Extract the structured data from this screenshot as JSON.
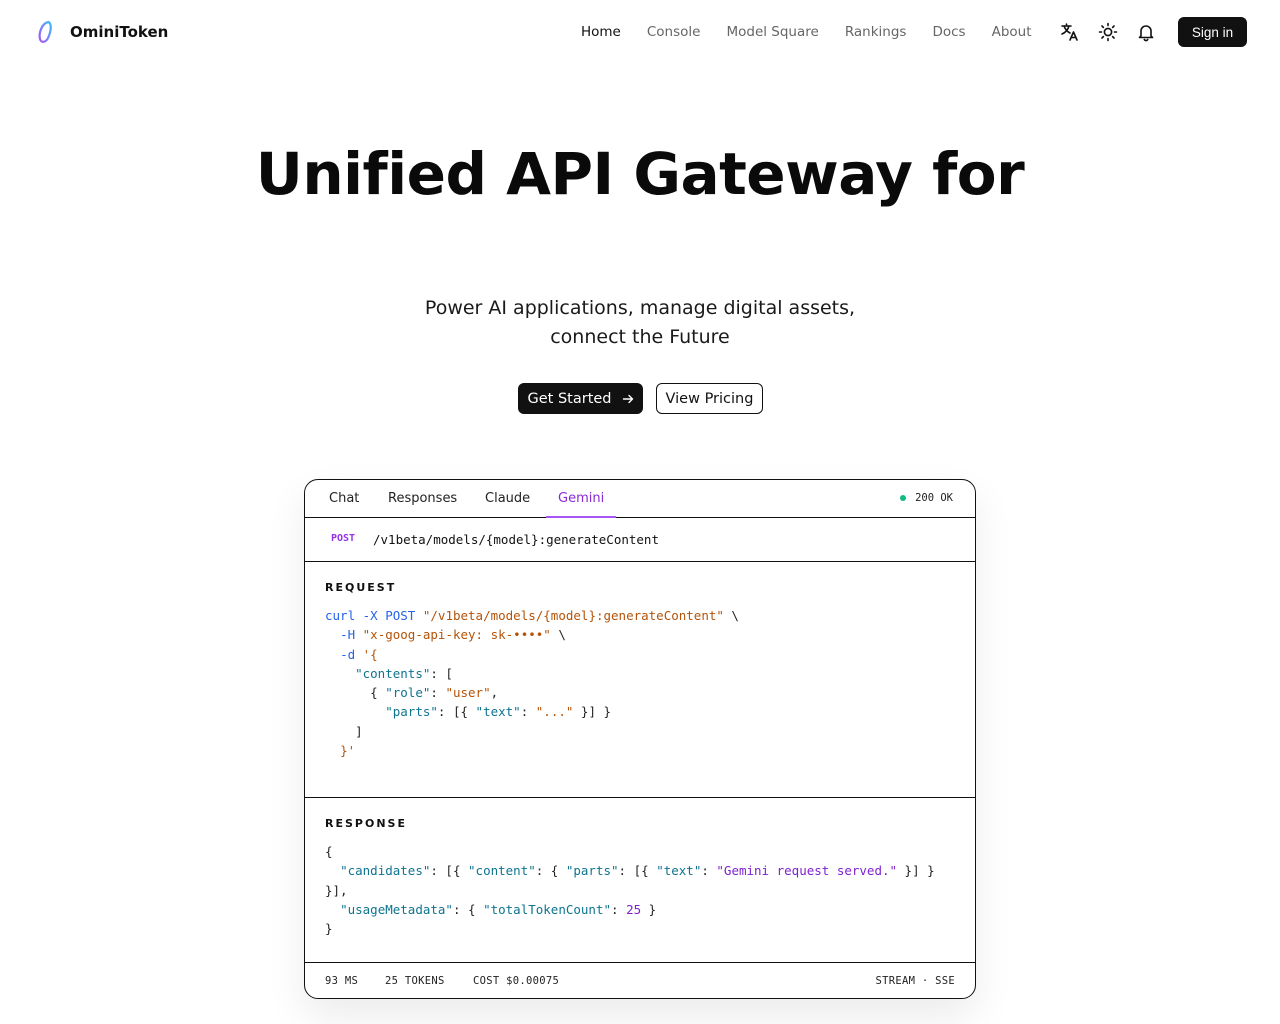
{
  "header": {
    "brand": "OminiToken",
    "logo_icon": "ribbon-o-logo",
    "nav": [
      {
        "label": "Home",
        "active": true
      },
      {
        "label": "Console",
        "active": false
      },
      {
        "label": "Model Square",
        "active": false
      },
      {
        "label": "Rankings",
        "active": false
      },
      {
        "label": "Docs",
        "active": false
      },
      {
        "label": "About",
        "active": false
      }
    ],
    "icons": [
      "translate-icon",
      "sun-icon",
      "bell-icon"
    ],
    "signin_label": "Sign in"
  },
  "hero": {
    "title": "Unified API Gateway for",
    "subtitle": "Power AI applications, manage digital assets, connect the Future",
    "primary_cta": "Get Started",
    "primary_cta_icon": "arrow-right-icon",
    "secondary_cta": "View Pricing"
  },
  "demo": {
    "tabs": [
      {
        "label": "Chat",
        "active": false
      },
      {
        "label": "Responses",
        "active": false
      },
      {
        "label": "Claude",
        "active": false
      },
      {
        "label": "Gemini",
        "active": true
      }
    ],
    "status": "200 OK",
    "status_color": "#10b981",
    "accent_color": "#a855f7",
    "method": "POST",
    "path": "/v1beta/models/{model}:generateContent",
    "request_label": "REQUEST",
    "request_lines": [
      "curl -X POST \"/v1beta/models/{model}:generateContent\" \\",
      "  -H \"x-goog-api-key: sk-••••\" \\",
      "  -d '{",
      "    \"contents\": [",
      "      { \"role\": \"user\",",
      "        \"parts\": [{ \"text\": \"...\" }] }",
      "    ]",
      "  }'"
    ],
    "response_label": "RESPONSE",
    "response_lines": [
      "{",
      "  \"candidates\": [{ \"content\": { \"parts\": [{ \"text\": \"Gemini request served.\" }] }",
      "}],",
      "  \"usageMetadata\": { \"totalTokenCount\": 25 }",
      "}"
    ],
    "footer": {
      "latency": "93 MS",
      "tokens": "25 TOKENS",
      "cost": "COST $0.00075",
      "mode": "STREAM · SSE"
    }
  }
}
